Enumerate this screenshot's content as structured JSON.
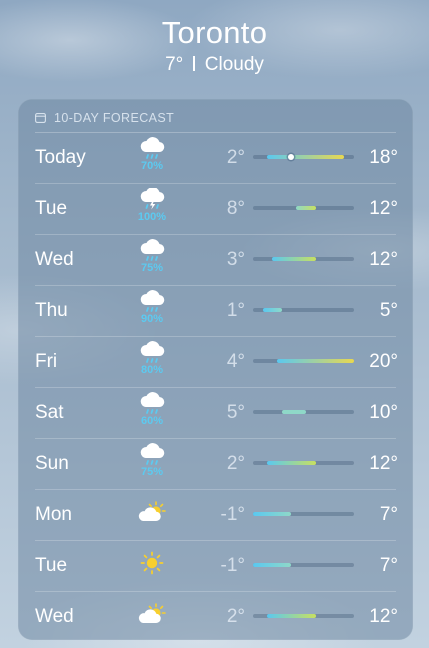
{
  "header": {
    "city": "Toronto",
    "temperature": "7°",
    "condition": "Cloudy"
  },
  "forecast": {
    "title": "10-DAY FORECAST",
    "title_icon": "calendar-icon",
    "range_min": -1,
    "range_max": 20,
    "current_temp": 7,
    "colors": {
      "precip_text": "#5ccaf0",
      "cold": "#5ac8f0",
      "mild": "#8fd8c8",
      "warm": "#c8e060",
      "hot": "#e8d850"
    },
    "days": [
      {
        "day": "Today",
        "icon": "cloud-rain-icon",
        "precip": "70%",
        "low": "2°",
        "high": "18°",
        "low_val": 2,
        "high_val": 18,
        "current": true
      },
      {
        "day": "Tue",
        "icon": "cloud-bolt-rain-icon",
        "precip": "100%",
        "low": "8°",
        "high": "12°",
        "low_val": 8,
        "high_val": 12
      },
      {
        "day": "Wed",
        "icon": "cloud-rain-icon",
        "precip": "75%",
        "low": "3°",
        "high": "12°",
        "low_val": 3,
        "high_val": 12
      },
      {
        "day": "Thu",
        "icon": "cloud-rain-icon",
        "precip": "90%",
        "low": "1°",
        "high": "5°",
        "low_val": 1,
        "high_val": 5
      },
      {
        "day": "Fri",
        "icon": "cloud-rain-icon",
        "precip": "80%",
        "low": "4°",
        "high": "20°",
        "low_val": 4,
        "high_val": 20
      },
      {
        "day": "Sat",
        "icon": "cloud-rain-icon",
        "precip": "60%",
        "low": "5°",
        "high": "10°",
        "low_val": 5,
        "high_val": 10
      },
      {
        "day": "Sun",
        "icon": "cloud-rain-icon",
        "precip": "75%",
        "low": "2°",
        "high": "12°",
        "low_val": 2,
        "high_val": 12
      },
      {
        "day": "Mon",
        "icon": "partly-cloudy-icon",
        "precip": "",
        "low": "-1°",
        "high": "7°",
        "low_val": -1,
        "high_val": 7
      },
      {
        "day": "Tue",
        "icon": "sun-icon",
        "precip": "",
        "low": "-1°",
        "high": "7°",
        "low_val": -1,
        "high_val": 7
      },
      {
        "day": "Wed",
        "icon": "partly-cloudy-icon",
        "precip": "",
        "low": "2°",
        "high": "12°",
        "low_val": 2,
        "high_val": 12
      }
    ]
  }
}
